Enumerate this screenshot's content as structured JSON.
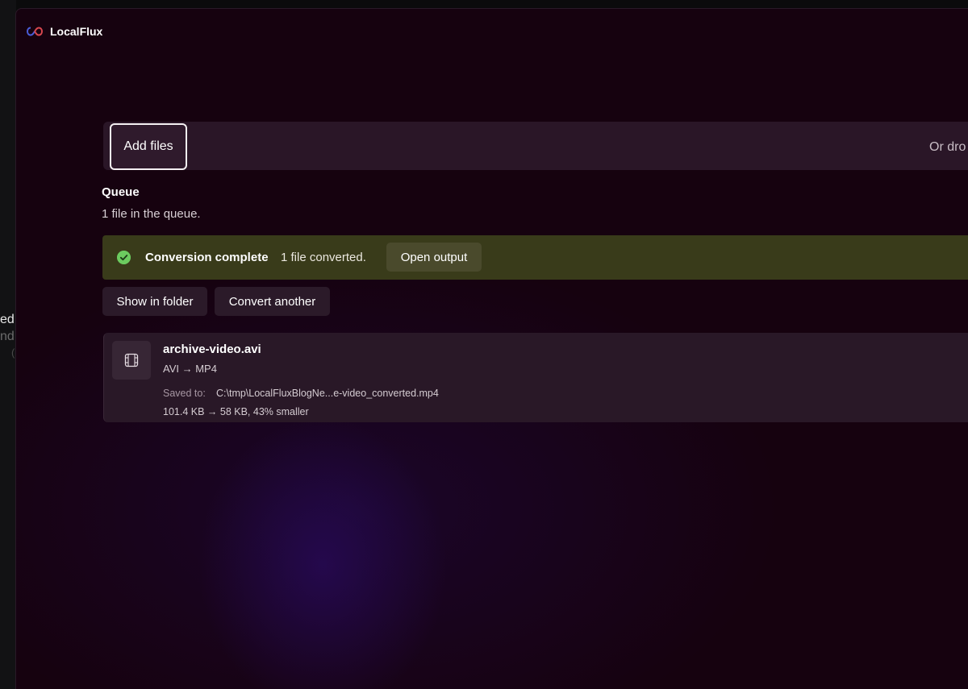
{
  "app": {
    "title": "LocalFlux",
    "logo_icon": "infinity-logo-icon"
  },
  "background_window": {
    "fragment_1": "ed",
    "fragment_2": "nd"
  },
  "toolbar": {
    "add_files_label": "Add files",
    "drop_hint": "Or dro"
  },
  "queue": {
    "heading": "Queue",
    "count_text": "1 file in the queue."
  },
  "banner": {
    "status_icon": "check-circle-icon",
    "title": "Conversion complete",
    "message": "1 file converted.",
    "open_output_label": "Open output",
    "color": "#393b1a",
    "icon_color": "#6ccb5f"
  },
  "actions": {
    "show_in_folder_label": "Show in folder",
    "convert_another_label": "Convert another"
  },
  "file": {
    "icon": "video-film-icon",
    "name": "archive-video.avi",
    "conversion": "AVI → MP4",
    "saved_label": "Saved to:",
    "saved_path": "C:\\tmp\\LocalFluxBlogNe...e-video_converted.mp4",
    "size_info": "101.4 KB → 58 KB, 43% smaller"
  }
}
